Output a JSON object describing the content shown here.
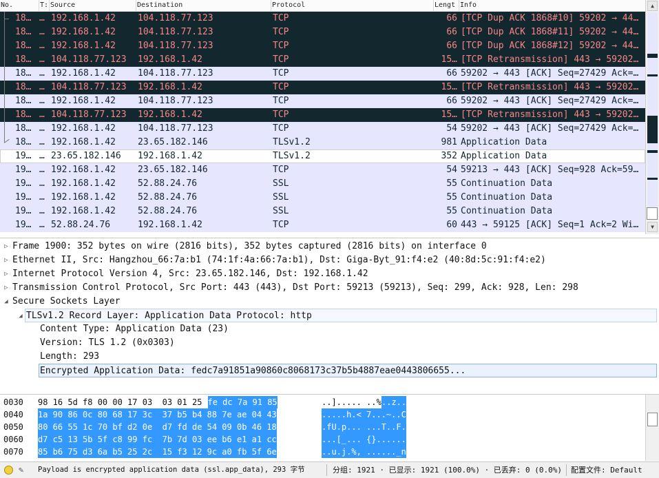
{
  "packet_list": {
    "columns": [
      "No.",
      "T:",
      "Source",
      "Destination",
      "Protocol",
      "Lengt",
      "Info"
    ],
    "rows": [
      {
        "no": "18…",
        "time": "…",
        "src": "192.168.1.42",
        "dst": "104.118.77.123",
        "proto": "TCP",
        "len": "66",
        "info": "[TCP Dup ACK 1868#10] 59202 → 44…",
        "style": "dark"
      },
      {
        "no": "18…",
        "time": "…",
        "src": "192.168.1.42",
        "dst": "104.118.77.123",
        "proto": "TCP",
        "len": "66",
        "info": "[TCP Dup ACK 1868#11] 59202 → 44…",
        "style": "dark"
      },
      {
        "no": "18…",
        "time": "…",
        "src": "192.168.1.42",
        "dst": "104.118.77.123",
        "proto": "TCP",
        "len": "66",
        "info": "[TCP Dup ACK 1868#12] 59202 → 44…",
        "style": "dark"
      },
      {
        "no": "18…",
        "time": "…",
        "src": "104.118.77.123",
        "dst": "192.168.1.42",
        "proto": "TCP",
        "len": "15…",
        "info": "[TCP Retransmission] 443 → 59202…",
        "style": "dark"
      },
      {
        "no": "18…",
        "time": "…",
        "src": "192.168.1.42",
        "dst": "104.118.77.123",
        "proto": "TCP",
        "len": "66",
        "info": "59202 → 443 [ACK] Seq=27429 Ack=…",
        "style": "light"
      },
      {
        "no": "18…",
        "time": "…",
        "src": "104.118.77.123",
        "dst": "192.168.1.42",
        "proto": "TCP",
        "len": "15…",
        "info": "[TCP Retransmission] 443 → 59202…",
        "style": "dark"
      },
      {
        "no": "18…",
        "time": "…",
        "src": "192.168.1.42",
        "dst": "104.118.77.123",
        "proto": "TCP",
        "len": "66",
        "info": "59202 → 443 [ACK] Seq=27429 Ack=…",
        "style": "light"
      },
      {
        "no": "18…",
        "time": "…",
        "src": "104.118.77.123",
        "dst": "192.168.1.42",
        "proto": "TCP",
        "len": "15…",
        "info": "[TCP Retransmission] 443 → 59202…",
        "style": "dark"
      },
      {
        "no": "18…",
        "time": "…",
        "src": "192.168.1.42",
        "dst": "104.118.77.123",
        "proto": "TCP",
        "len": "54",
        "info": "59202 → 443 [ACK] Seq=27429 Ack=…",
        "style": "light"
      },
      {
        "no": "18…",
        "time": "…",
        "src": "192.168.1.42",
        "dst": "23.65.182.146",
        "proto": "TLSv1.2",
        "len": "981",
        "info": "Application Data",
        "style": "light"
      },
      {
        "no": "19…",
        "time": "…",
        "src": "23.65.182.146",
        "dst": "192.168.1.42",
        "proto": "TLSv1.2",
        "len": "352",
        "info": "Application Data",
        "style": "selected"
      },
      {
        "no": "19…",
        "time": "…",
        "src": "192.168.1.42",
        "dst": "23.65.182.146",
        "proto": "TCP",
        "len": "54",
        "info": "59213 → 443 [ACK] Seq=928 Ack=59…",
        "style": "light"
      },
      {
        "no": "19…",
        "time": "…",
        "src": "192.168.1.42",
        "dst": "52.88.24.76",
        "proto": "SSL",
        "len": "55",
        "info": "Continuation Data",
        "style": "light"
      },
      {
        "no": "19…",
        "time": "…",
        "src": "192.168.1.42",
        "dst": "52.88.24.76",
        "proto": "SSL",
        "len": "55",
        "info": "Continuation Data",
        "style": "light"
      },
      {
        "no": "19…",
        "time": "…",
        "src": "192.168.1.42",
        "dst": "52.88.24.76",
        "proto": "SSL",
        "len": "55",
        "info": "Continuation Data",
        "style": "light"
      },
      {
        "no": "19…",
        "time": "…",
        "src": "52.88.24.76",
        "dst": "192.168.1.42",
        "proto": "TCP",
        "len": "60",
        "info": "443 → 59125 [ACK] Seq=1 Ack=2 Wi…",
        "style": "light"
      }
    ]
  },
  "details": [
    {
      "text": "Frame 1900: 352 bytes on wire (2816 bits), 352 bytes captured (2816 bits) on interface 0",
      "level": 0,
      "expanded": false
    },
    {
      "text": "Ethernet II, Src: Hangzhou_66:7a:b1 (74:1f:4a:66:7a:b1), Dst: Giga-Byt_91:f4:e2 (40:8d:5c:91:f4:e2)",
      "level": 0,
      "expanded": false
    },
    {
      "text": "Internet Protocol Version 4, Src: 23.65.182.146, Dst: 192.168.1.42",
      "level": 0,
      "expanded": false
    },
    {
      "text": "Transmission Control Protocol, Src Port: 443 (443), Dst Port: 59213 (59213), Seq: 299, Ack: 928, Len: 298",
      "level": 0,
      "expanded": false
    },
    {
      "text": "Secure Sockets Layer",
      "level": 0,
      "expanded": true
    },
    {
      "text": "TLSv1.2 Record Layer: Application Data Protocol: http",
      "level": 1,
      "expanded": true
    },
    {
      "text": "Content Type: Application Data (23)",
      "level": 2,
      "expanded": null
    },
    {
      "text": "Version: TLS 1.2 (0x0303)",
      "level": 2,
      "expanded": null
    },
    {
      "text": "Length: 293",
      "level": 2,
      "expanded": null
    },
    {
      "text": "Encrypted Application Data: fedc7a91851a90860c8068173c37b5b4887eae0443806655...",
      "level": 2,
      "expanded": null
    }
  ],
  "bytes": [
    {
      "offset": "0030",
      "hex_plain": "98 16 5d f8 00 00 17 03  03 01 25 ",
      "hex_hl": "fe dc 7a 91 85",
      "ascii_plain": "..]..... ..%",
      "ascii_hl": "..z.."
    },
    {
      "offset": "0040",
      "hex_plain": "",
      "hex_hl": "1a 90 86 0c 80 68 17 3c  37 b5 b4 88 7e ae 04 43",
      "ascii_plain": "",
      "ascii_hl": ".....h.< 7...~..C"
    },
    {
      "offset": "0050",
      "hex_plain": "",
      "hex_hl": "80 66 55 1c 70 bf d2 0e  d7 fd de 54 09 0b 46 18",
      "ascii_plain": "",
      "ascii_hl": ".fU.p... ...T..F."
    },
    {
      "offset": "0060",
      "hex_plain": "",
      "hex_hl": "d7 c5 13 5b 5f c8 99 fc  7b 7d 03 ee b6 e1 a1 cc",
      "ascii_plain": "",
      "ascii_hl": "...[_... {}......"
    },
    {
      "offset": "0070",
      "hex_plain": "",
      "hex_hl": "85 b6 75 d3 6a b5 25 2c  15 f3 12 9c a0 fb 5f 6e",
      "ascii_plain": "",
      "ascii_hl": "..u.j.%, ......_n"
    }
  ],
  "statusbar": {
    "message": "Payload is encrypted application data (ssl.app_data), 293 字节",
    "packets": "分组: 1921 · 已显示: 1921 (100.0%) · 已丢弃: 0 (0.0%)",
    "profile": "配置文件: Default"
  },
  "colors": {
    "light_row_bg": "#e7e6ff",
    "dark_row_bg": "#12272e",
    "dark_row_fg": "#f78787",
    "byte_highlight": "#3399ff"
  }
}
